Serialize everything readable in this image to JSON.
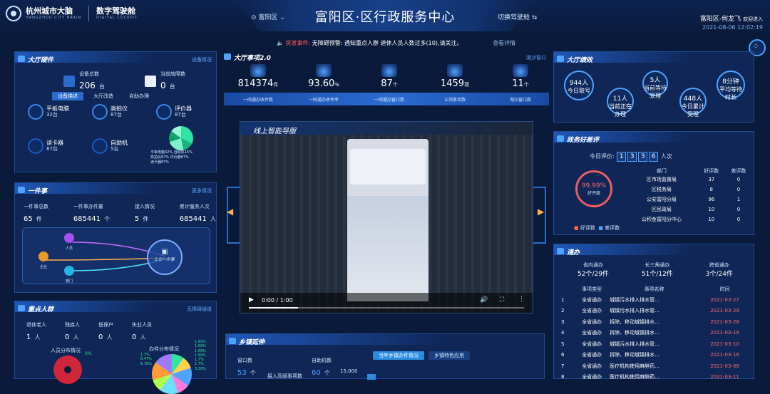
{
  "header": {
    "logo_cn": "杭州城市大脑",
    "logo_en": "HANGZHOU CITY BRAIN",
    "cockpit_cn": "数字驾驶舱",
    "cockpit_en": "DIGITAL COCKPIT",
    "location": "富阳区",
    "title": "富阳区·区行政服务中心",
    "switch_label": "切换驾驶舱",
    "user": "富阳区-何龙飞",
    "welcome": "欢迎进入",
    "datetime": "2021-08-06 12:02:19"
  },
  "alert": {
    "label": "突发事件:",
    "text": "无障碍预警: 遇知重点人群 退休人员人数过多(10),请关注。",
    "more": "查看详情"
  },
  "hall_hardware": {
    "title": "大厅硬件",
    "link": "设备情况",
    "total_label": "设备总数",
    "total_value": "206",
    "total_unit": "台",
    "fault_label": "当前故障数",
    "fault_value": "0",
    "fault_unit": "台",
    "tabs": [
      "设备描述",
      "大厅改造",
      "自助办理"
    ],
    "devices": [
      {
        "name": "平板电脑",
        "count": "32台"
      },
      {
        "name": "高拍仪",
        "count": "87台"
      },
      {
        "name": "评价器",
        "count": "87台"
      },
      {
        "name": "读卡器",
        "count": "87台"
      },
      {
        "name": "自助机",
        "count": "5台"
      }
    ],
    "legend": [
      "平板电脑32%",
      "自助机15%",
      "高拍仪87%",
      "评价器87%",
      "读卡器87%"
    ]
  },
  "one_thing": {
    "title": "一件事",
    "link": "更多情况",
    "stats": [
      {
        "label": "一件事总数",
        "value": "65",
        "unit": "件"
      },
      {
        "label": "一件事办件量",
        "value": "685441",
        "unit": "个"
      },
      {
        "label": "接入情况",
        "value": "5",
        "unit": "件"
      },
      {
        "label": "累计服务人次",
        "value": "685441",
        "unit": "人"
      }
    ],
    "nodes": [
      "人员",
      "企业",
      "部门"
    ],
    "center": "2.0一件事"
  },
  "key_people": {
    "title": "重点人群",
    "link": "无障碍通道",
    "groups": [
      {
        "label": "退休老人",
        "value": "1",
        "unit": "人"
      },
      {
        "label": "残疾人",
        "value": "0",
        "unit": "人"
      },
      {
        "label": "低保户",
        "value": "0",
        "unit": "人"
      },
      {
        "label": "失业人员",
        "value": "0",
        "unit": "人"
      }
    ],
    "dist_title": "人员分布情况",
    "work_dist_title": "办件分布情况",
    "pct_labels": [
      "0%",
      "1.69%",
      "1.69%",
      "1.69%",
      "1.69%",
      "1.7%",
      "1.7%",
      "1.7%",
      "3.39%",
      "8.47%",
      "6.78%"
    ]
  },
  "hall_affairs": {
    "title": "大厅事项2.0",
    "link": "湖沙窗口",
    "kpis": [
      {
        "value": "814374",
        "unit": "件",
        "label": "一网通办收件数"
      },
      {
        "value": "93.60",
        "unit": "%",
        "label": "一网通办收件率"
      },
      {
        "value": "87",
        "unit": "个",
        "label": "一网通办窗口数"
      },
      {
        "value": "1459",
        "unit": "项",
        "label": "认领事项数"
      },
      {
        "value": "11",
        "unit": "个",
        "label": "湖沙窗口数"
      }
    ]
  },
  "video": {
    "title": "线上智能导服",
    "time": "0:00 / 1:00"
  },
  "township": {
    "title": "乡镇延伸",
    "tabs": [
      "当年乡镇办件情况",
      "乡镇特色应用"
    ],
    "window_label": "窗口数",
    "window_value": "53",
    "window_unit": "个",
    "self_label": "自助机数",
    "self_value": "60",
    "self_unit": "个",
    "access_label": "接入高频事项数",
    "axis_tick": "15,000"
  },
  "hall_performance": {
    "title": "大厅绩效",
    "items": [
      {
        "value": "944人",
        "label": "今日取号"
      },
      {
        "value": "11人",
        "label": "当前正在办理"
      },
      {
        "value": "5人",
        "label": "当前等待受理"
      },
      {
        "value": "448人",
        "label": "今日累计受理"
      },
      {
        "value": "8分钟",
        "label": "平均等待时长"
      }
    ]
  },
  "evaluation": {
    "title": "政务好差评",
    "today_label": "今日评价:",
    "today_digits": [
      "1",
      "3",
      "3",
      "6"
    ],
    "today_unit": "人次",
    "rate": "99.99%",
    "rate_label": "好评度",
    "headers": [
      "部门",
      "好评数",
      "差评数"
    ],
    "rows": [
      [
        "区市场监督局",
        "37",
        "0"
      ],
      [
        "区税务局",
        "8",
        "0"
      ],
      [
        "公安富阳分局",
        "96",
        "1"
      ],
      [
        "区民政局",
        "10",
        "0"
      ],
      [
        "公积金富阳分中心",
        "10",
        "0"
      ]
    ],
    "legend_good": "好评数",
    "legend_bad": "差评数"
  },
  "tong_ban": {
    "title": "通办",
    "summary": [
      {
        "label": "省内通办",
        "value": "52个/29件"
      },
      {
        "label": "长三角通办",
        "value": "51个/12件"
      },
      {
        "label": "跨省通办",
        "value": "3个/24件"
      }
    ],
    "headers": [
      "事项类型",
      "事项名称",
      "时间"
    ],
    "rows": [
      [
        "1",
        "全省通办",
        "城镇污水排入排水管...",
        "2021-03-27"
      ],
      [
        "2",
        "全省通办",
        "城镇污水排入排水管...",
        "2021-03-29"
      ],
      [
        "3",
        "全省通办",
        "拆除、移动城镇排水...",
        "2021-03-28"
      ],
      [
        "4",
        "全省通办",
        "拆除、移动城镇排水...",
        "2021-03-18"
      ],
      [
        "5",
        "全省通办",
        "城镇污水排入排水管...",
        "2021-03-10"
      ],
      [
        "6",
        "全省通办",
        "拆除、移动城镇排水...",
        "2021-03-16"
      ],
      [
        "7",
        "全省通办",
        "医疗机构使用麻醉药...",
        "2021-03-08"
      ],
      [
        "8",
        "全省通办",
        "医疗机构使用麻醉药...",
        "2021-03-11"
      ]
    ]
  },
  "colors": {
    "accent": "#4fa3ff",
    "background": "#0a1a3a",
    "alert_red": "#ff5a5a",
    "date_red": "#ff6a6a"
  }
}
